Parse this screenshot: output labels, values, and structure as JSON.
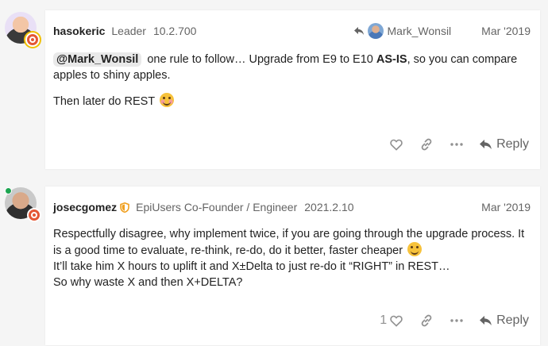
{
  "posts": [
    {
      "username": "hasokeric",
      "title": "Leader",
      "version": "10.2.700",
      "reply_to": "Mark_Wonsil",
      "date": "Mar '2019",
      "mention": "@Mark_Wonsil",
      "text_a": " one rule to follow… Upgrade from E9 to E10 ",
      "text_bold": "AS-IS",
      "text_b": ", so you can compare apples to shiny apples.",
      "line2": "Then later do REST ",
      "actions": {
        "reply_label": "Reply"
      }
    },
    {
      "username": "josecgomez",
      "title": "EpiUsers Co-Founder / Engineer",
      "version": "2021.2.10",
      "date": "Mar '2019",
      "line1": "Respectfully disagree, why implement twice, if you are going through the upgrade process. It is a good time to evaluate, re-think, re-do, do it better, faster cheaper ",
      "line2": "It’ll take him X hours to uplift it and X±Delta to just re-do it “RIGHT” in REST…",
      "line3": "So why waste X and then X+DELTA?",
      "actions": {
        "like_count": "1",
        "reply_label": "Reply"
      }
    }
  ]
}
